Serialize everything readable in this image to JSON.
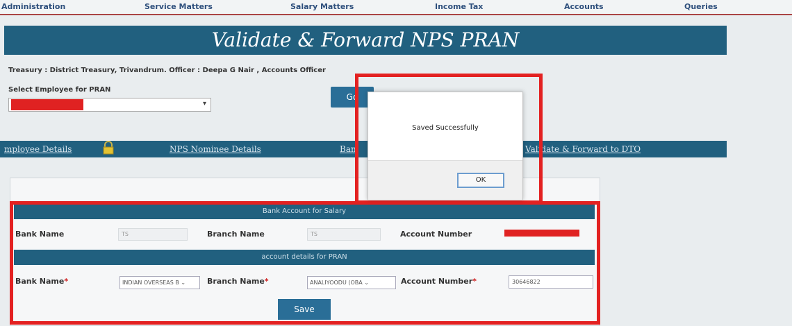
{
  "menu": [
    {
      "label": "Administration"
    },
    {
      "label": "Service Matters"
    },
    {
      "label": "Salary Matters"
    },
    {
      "label": "Income Tax"
    },
    {
      "label": "Accounts"
    },
    {
      "label": "Queries"
    }
  ],
  "page_title": "Validate & Forward NPS PRAN",
  "treasury_line": "Treasury : District Treasury, Trivandrum. Officer : Deepa G Nair , Accounts Officer",
  "select_employee_label": "Select Employee for PRAN",
  "go_button": "Go",
  "tabs": [
    {
      "label": "mployee Details"
    },
    {
      "label": "NPS Nominee Details"
    },
    {
      "label": "Ban"
    },
    {
      "label": "Validate & Forward to DTO"
    }
  ],
  "salary_section": {
    "title": "Bank Account for Salary",
    "bank_name_label": "Bank Name",
    "bank_name_value": "TS",
    "branch_name_label": "Branch Name",
    "branch_name_value": "TS",
    "account_number_label": "Account Number"
  },
  "pran_section": {
    "title": "account details for PRAN",
    "bank_name_label": "Bank Name",
    "bank_name_value": "INDIAN OVERSEAS B",
    "branch_name_label": "Branch Name",
    "branch_name_value": "ANALIYOODU (OBA",
    "account_number_label": "Account Number",
    "account_number_value": "30646822",
    "required_mark": "*"
  },
  "save_button": "Save",
  "dialog": {
    "message": "Saved Successfully",
    "ok_label": "OK"
  },
  "colors": {
    "header_bar": "#21607f",
    "highlight_red": "#e32121"
  }
}
